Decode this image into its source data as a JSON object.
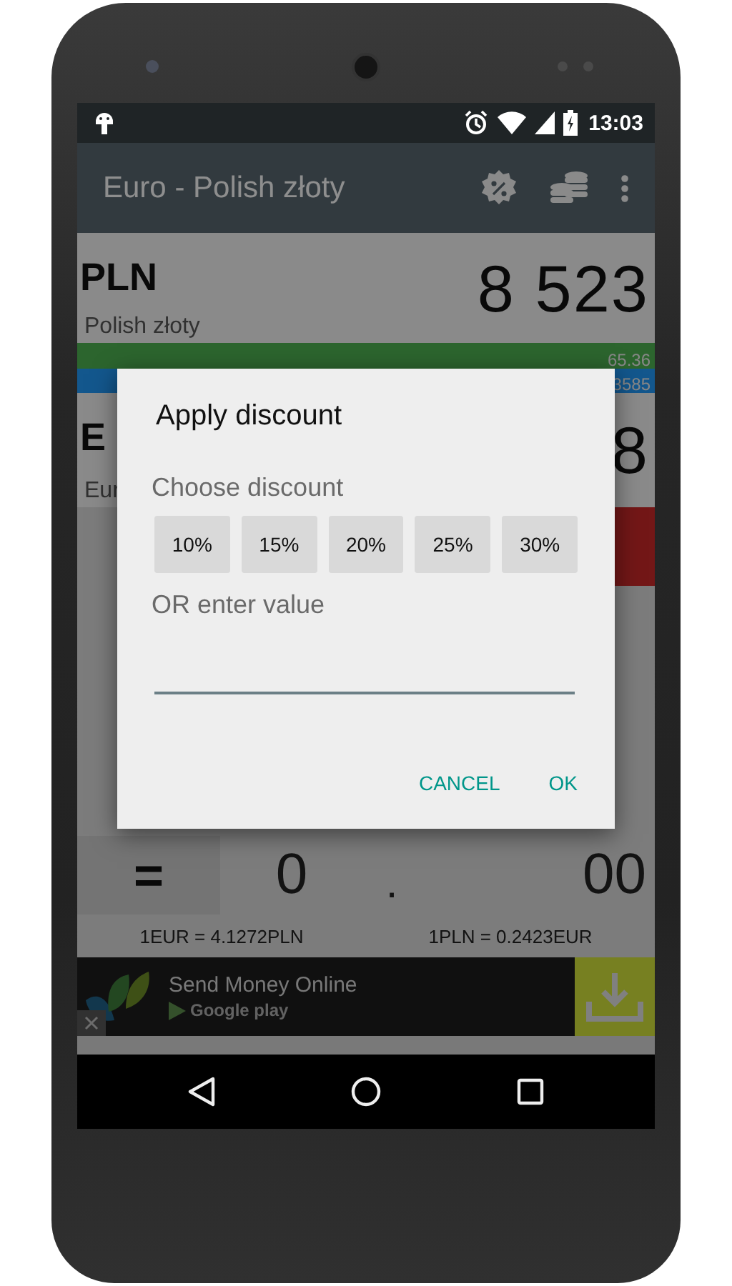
{
  "status_bar": {
    "time": "13:03"
  },
  "app_bar": {
    "title": "Euro - Polish złoty"
  },
  "currencies": [
    {
      "code": "PLN",
      "name": "Polish złoty",
      "amount": "8 523"
    },
    {
      "code": "E",
      "name": "Eur",
      "amount": "8"
    }
  ],
  "rate_bars": [
    {
      "value": "65.36"
    },
    {
      "value": "3585"
    }
  ],
  "result": {
    "operator": "=",
    "integer": "0",
    "separator": ".",
    "decimals": "00"
  },
  "rates": [
    "1EUR = 4.1272PLN",
    "1PLN = 0.2423EUR"
  ],
  "ad": {
    "title": "Send Money Online",
    "store": "Google play"
  },
  "dialog": {
    "title": "Apply discount",
    "choose_label": "Choose discount",
    "options": [
      "10%",
      "15%",
      "20%",
      "25%",
      "30%"
    ],
    "value_label": "OR enter value",
    "buttons": [
      "CANCEL",
      "OK"
    ]
  }
}
